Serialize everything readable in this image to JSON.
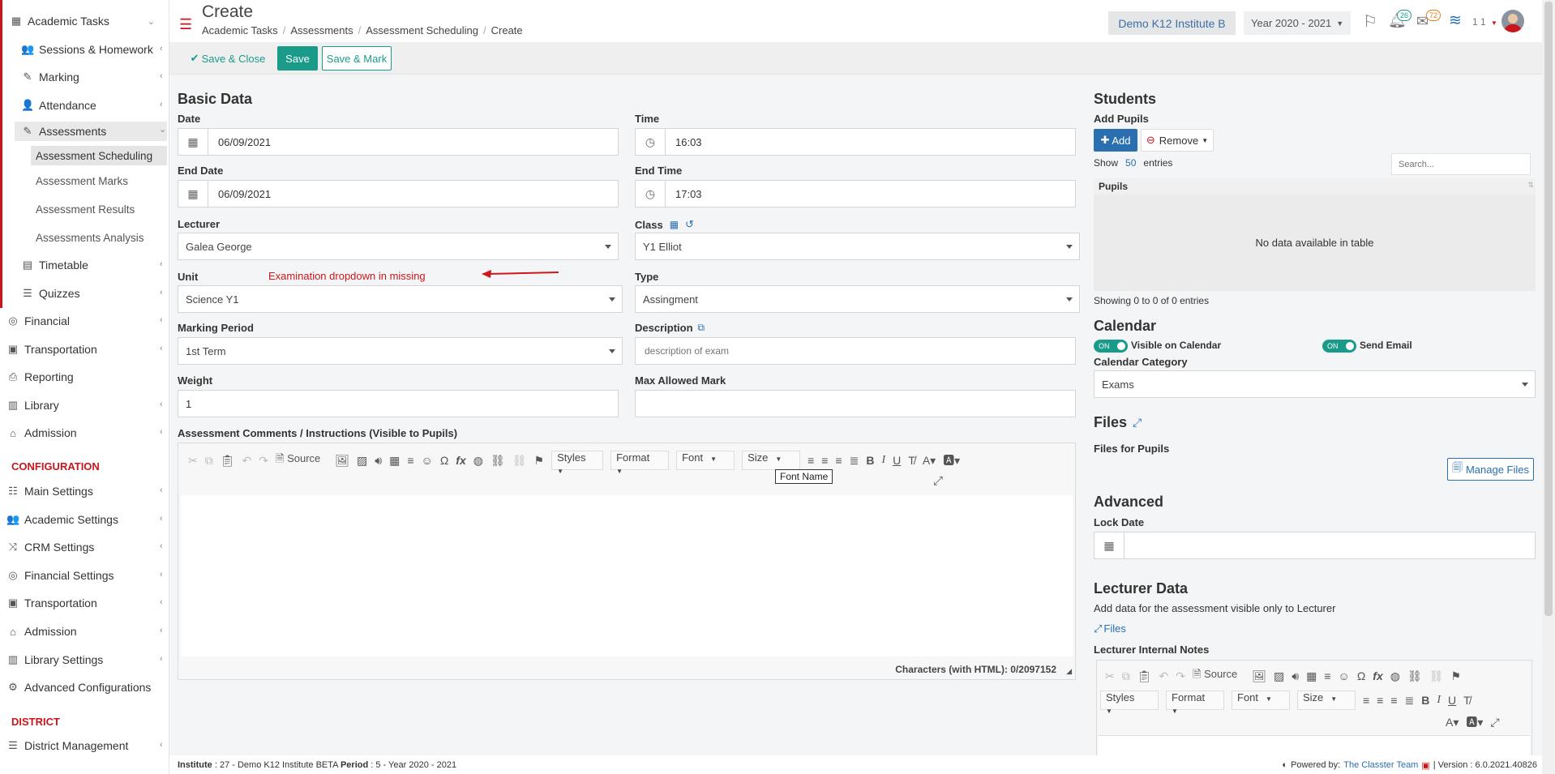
{
  "sidebar": {
    "items": [
      {
        "label": "Academic Tasks",
        "icon": "grid-icon"
      },
      {
        "label": "Sessions & Homework",
        "icon": "users-icon"
      },
      {
        "label": "Marking",
        "icon": "edit-icon"
      },
      {
        "label": "Attendance",
        "icon": "user-x-icon"
      },
      {
        "label": "Assessments",
        "icon": "pencil-square-icon"
      },
      {
        "label": "Assessment Scheduling"
      },
      {
        "label": "Assessment Marks"
      },
      {
        "label": "Assessment Results"
      },
      {
        "label": "Assessments Analysis"
      },
      {
        "label": "Timetable",
        "icon": "calendar-icon"
      },
      {
        "label": "Quizzes",
        "icon": "list-icon"
      },
      {
        "label": "Financial",
        "icon": "coins-icon"
      },
      {
        "label": "Transportation",
        "icon": "bus-icon"
      },
      {
        "label": "Reporting",
        "icon": "printer-icon"
      },
      {
        "label": "Library",
        "icon": "books-icon"
      },
      {
        "label": "Admission",
        "icon": "bank-icon"
      }
    ],
    "config_title": "CONFIGURATION",
    "config_items": [
      {
        "label": "Main Settings",
        "icon": "sliders-icon"
      },
      {
        "label": "Academic Settings",
        "icon": "users-icon"
      },
      {
        "label": "CRM Settings",
        "icon": "shuffle-icon"
      },
      {
        "label": "Financial Settings",
        "icon": "coins-icon"
      },
      {
        "label": "Transportation",
        "icon": "bus-icon"
      },
      {
        "label": "Admission",
        "icon": "bank-icon"
      },
      {
        "label": "Library Settings",
        "icon": "books-icon"
      },
      {
        "label": "Advanced Configurations",
        "icon": "gears-icon"
      }
    ],
    "district_title": "DISTRICT",
    "district_items": [
      {
        "label": "District Management",
        "icon": "menu-icon"
      }
    ]
  },
  "header": {
    "title": "Create",
    "breadcrumb": [
      "Academic Tasks",
      "Assessments",
      "Assessment Scheduling",
      "Create"
    ],
    "institute": "Demo K12 Institute B",
    "year": "Year 2020 - 2021",
    "notif_count": "26",
    "mail_count": "72",
    "user_short": "1 1"
  },
  "toolbar": {
    "save_close": "Save & Close",
    "save": "Save",
    "save_mark": "Save & Mark"
  },
  "basic": {
    "title": "Basic Data",
    "date_label": "Date",
    "date": "06/09/2021",
    "time_label": "Time",
    "time": "16:03",
    "end_date_label": "End Date",
    "end_date": "06/09/2021",
    "end_time_label": "End Time",
    "end_time": "17:03",
    "lecturer_label": "Lecturer",
    "lecturer": "Galea George",
    "class_label": "Class",
    "class": "Y1 Elliot",
    "unit_label": "Unit",
    "unit": "Science Y1",
    "annotation": "Examination dropdown in missing",
    "type_label": "Type",
    "type": "Assingment",
    "period_label": "Marking Period",
    "period": "1st Term",
    "desc_label": "Description",
    "desc_placeholder": "description of exam",
    "weight_label": "Weight",
    "weight": "1",
    "max_label": "Max Allowed Mark",
    "max": "",
    "comments_label": "Assessment Comments / Instructions (Visible to Pupils)"
  },
  "editor": {
    "source": "Source",
    "styles": "Styles",
    "format": "Format",
    "font": "Font",
    "size": "Size",
    "tooltip": "Font Name",
    "char_count": "Characters (with HTML): 0/2097152"
  },
  "students": {
    "title": "Students",
    "add_pupils": "Add Pupils",
    "add": "Add",
    "remove": "Remove",
    "show": "Show",
    "entries_num": "50",
    "entries": "entries",
    "search_placeholder": "Search...",
    "col_pupils": "Pupils",
    "empty": "No data available in table",
    "showing": "Showing 0 to 0 of 0 entries"
  },
  "calendar": {
    "title": "Calendar",
    "on": "ON",
    "visible": "Visible on Calendar",
    "email": "Send Email",
    "cat_label": "Calendar Category",
    "cat": "Exams"
  },
  "files": {
    "title": "Files",
    "for_pupils": "Files for Pupils",
    "manage": "Manage Files"
  },
  "advanced": {
    "title": "Advanced",
    "lock_label": "Lock Date"
  },
  "lecturer_data": {
    "title": "Lecturer Data",
    "desc": "Add data for the assessment visible only to Lecturer",
    "files": "Files",
    "notes_label": "Lecturer Internal Notes"
  },
  "footer": {
    "left_a": "Institute",
    "left_b": ": 27 - Demo K12 Institute BETA",
    "left_c": "Period",
    "left_d": ": 5 - Year 2020 - 2021",
    "powered": "Powered by:",
    "team": "The Classter Team",
    "version": "| Version : 6.0.2021.40826"
  },
  "colors": {
    "brand_red": "#c9151b",
    "teal": "#1a9b8a",
    "link_blue": "#2a6fb0"
  }
}
